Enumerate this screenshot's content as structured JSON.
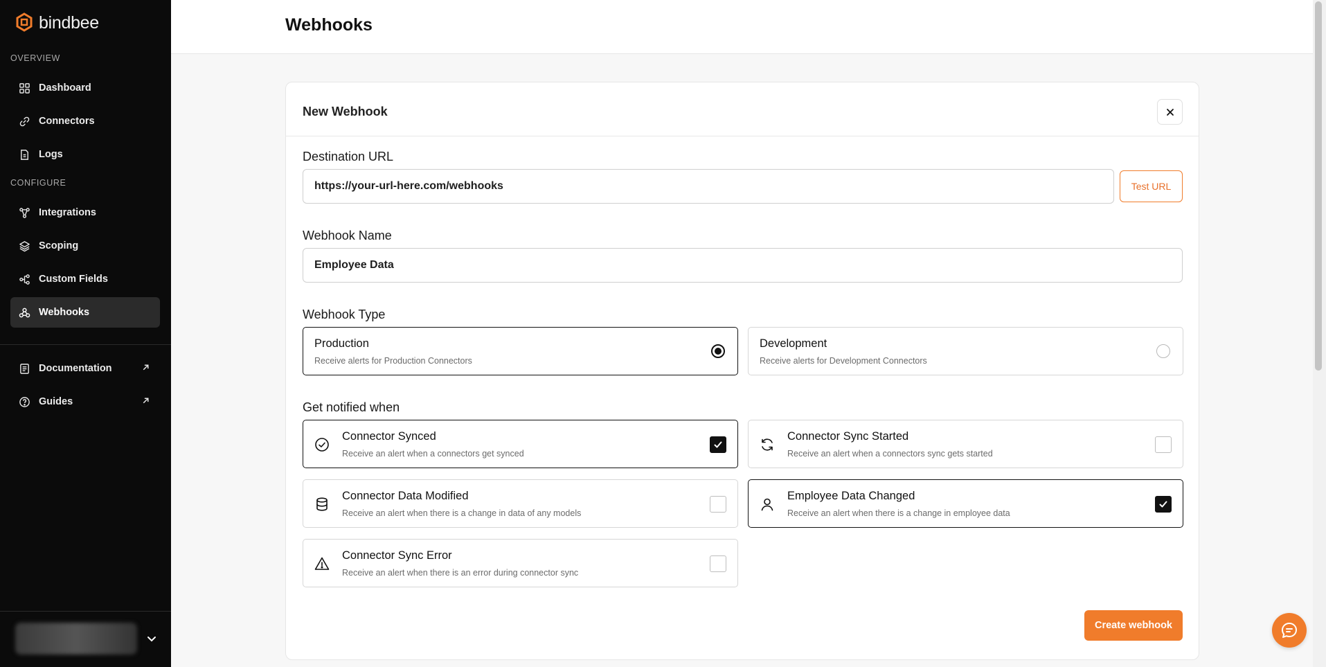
{
  "brand": {
    "name": "bindbee",
    "accent": "#f07c2b"
  },
  "sidebar": {
    "sections": [
      {
        "label": "OVERVIEW"
      },
      {
        "label": "CONFIGURE"
      }
    ],
    "items": [
      {
        "label": "Dashboard",
        "icon": "grid-icon"
      },
      {
        "label": "Connectors",
        "icon": "link-icon"
      },
      {
        "label": "Logs",
        "icon": "file-icon"
      },
      {
        "label": "Integrations",
        "icon": "integrations-icon"
      },
      {
        "label": "Scoping",
        "icon": "layers-icon"
      },
      {
        "label": "Custom Fields",
        "icon": "nodes-icon"
      },
      {
        "label": "Webhooks",
        "icon": "webhook-icon",
        "active": true
      }
    ],
    "links": [
      {
        "label": "Documentation",
        "icon": "document-icon"
      },
      {
        "label": "Guides",
        "icon": "help-circle-icon"
      }
    ]
  },
  "header": {
    "title": "Webhooks"
  },
  "form": {
    "title": "New Webhook",
    "destination": {
      "label": "Destination URL",
      "value": "https://your-url-here.com/webhooks",
      "test_label": "Test URL"
    },
    "name": {
      "label": "Webhook Name",
      "value": "Employee Data"
    },
    "type": {
      "label": "Webhook Type",
      "options": [
        {
          "title": "Production",
          "desc": "Receive alerts for Production Connectors",
          "selected": true
        },
        {
          "title": "Development",
          "desc": "Receive alerts for Development Connectors",
          "selected": false
        }
      ]
    },
    "events": {
      "label": "Get notified when",
      "options": [
        {
          "title": "Connector Synced",
          "desc": "Receive an alert when a connectors get synced",
          "checked": true,
          "icon": "check-circle-icon"
        },
        {
          "title": "Connector Sync Started",
          "desc": "Receive an alert when a connectors sync gets started",
          "checked": false,
          "icon": "refresh-icon"
        },
        {
          "title": "Connector Data Modified",
          "desc": "Receive an alert when there is a change in data of any models",
          "checked": false,
          "icon": "database-icon"
        },
        {
          "title": "Employee Data Changed",
          "desc": "Receive an alert when there is a change in employee data",
          "checked": true,
          "icon": "user-icon"
        },
        {
          "title": "Connector Sync Error",
          "desc": "Receive an alert when there is an error during connector sync",
          "checked": false,
          "icon": "warning-icon"
        }
      ]
    },
    "submit_label": "Create webhook"
  }
}
